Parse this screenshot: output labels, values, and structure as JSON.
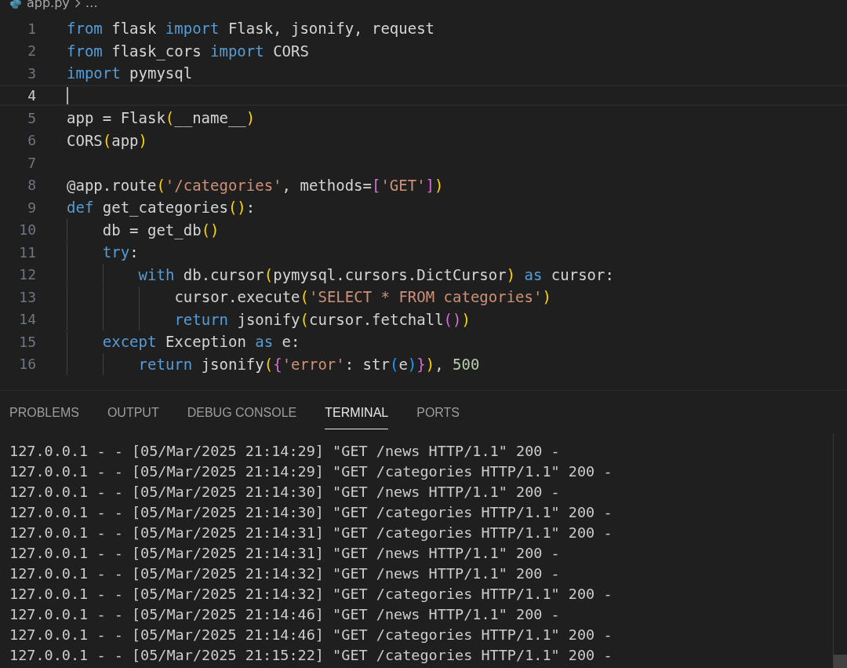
{
  "breadcrumb": {
    "file": "app.py",
    "more": "…"
  },
  "editor": {
    "lines": [
      {
        "number": "1",
        "current": false,
        "tokens": [
          {
            "kind": "keyword",
            "text": "from"
          },
          {
            "kind": "plain",
            "text": " flask "
          },
          {
            "kind": "keyword",
            "text": "import"
          },
          {
            "kind": "plain",
            "text": " Flask, jsonify, request"
          }
        ]
      },
      {
        "number": "2",
        "current": false,
        "tokens": [
          {
            "kind": "keyword",
            "text": "from"
          },
          {
            "kind": "plain",
            "text": " flask_cors "
          },
          {
            "kind": "keyword",
            "text": "import"
          },
          {
            "kind": "plain",
            "text": " CORS"
          }
        ]
      },
      {
        "number": "3",
        "current": false,
        "tokens": [
          {
            "kind": "keyword",
            "text": "import"
          },
          {
            "kind": "plain",
            "text": " pymysql"
          }
        ]
      },
      {
        "number": "4",
        "current": true
      },
      {
        "number": "5",
        "current": false,
        "tokens": [
          {
            "kind": "plain",
            "text": "app = Flask"
          },
          {
            "kind": "bracket1",
            "text": "("
          },
          {
            "kind": "plain",
            "text": "__name__"
          },
          {
            "kind": "bracket1",
            "text": ")"
          }
        ]
      },
      {
        "number": "6",
        "current": false,
        "tokens": [
          {
            "kind": "plain",
            "text": "CORS"
          },
          {
            "kind": "bracket1",
            "text": "("
          },
          {
            "kind": "plain",
            "text": "app"
          },
          {
            "kind": "bracket1",
            "text": ")"
          }
        ]
      },
      {
        "number": "7",
        "current": false
      },
      {
        "number": "8",
        "current": false,
        "tokens": [
          {
            "kind": "plain",
            "text": "@app.route"
          },
          {
            "kind": "bracket1",
            "text": "("
          },
          {
            "kind": "string",
            "text": "'/categories'"
          },
          {
            "kind": "plain",
            "text": ", methods="
          },
          {
            "kind": "bracket2",
            "text": "["
          },
          {
            "kind": "string",
            "text": "'GET'"
          },
          {
            "kind": "bracket2",
            "text": "]"
          },
          {
            "kind": "bracket1",
            "text": ")"
          }
        ]
      },
      {
        "number": "9",
        "current": false,
        "tokens": [
          {
            "kind": "keyword",
            "text": "def"
          },
          {
            "kind": "plain",
            "text": " get_categories"
          },
          {
            "kind": "bracket1",
            "text": "()"
          },
          {
            "kind": "plain",
            "text": ":"
          }
        ]
      },
      {
        "number": "10",
        "current": false,
        "tokens": [
          {
            "kind": "plain",
            "text": "    db = get_db"
          },
          {
            "kind": "bracket1",
            "text": "()"
          }
        ]
      },
      {
        "number": "11",
        "current": false,
        "tokens": [
          {
            "kind": "keyword",
            "text": "    try"
          },
          {
            "kind": "plain",
            "text": ":"
          }
        ]
      },
      {
        "number": "12",
        "current": false,
        "tokens": [
          {
            "kind": "keyword",
            "text": "        with"
          },
          {
            "kind": "plain",
            "text": " db.cursor"
          },
          {
            "kind": "bracket1",
            "text": "("
          },
          {
            "kind": "plain",
            "text": "pymysql.cursors.DictCursor"
          },
          {
            "kind": "bracket1",
            "text": ")"
          },
          {
            "kind": "keyword",
            "text": " as"
          },
          {
            "kind": "plain",
            "text": " cursor:"
          }
        ]
      },
      {
        "number": "13",
        "current": false,
        "tokens": [
          {
            "kind": "plain",
            "text": "            cursor.execute"
          },
          {
            "kind": "bracket1",
            "text": "("
          },
          {
            "kind": "string",
            "text": "'SELECT * FROM categories'"
          },
          {
            "kind": "bracket1",
            "text": ")"
          }
        ]
      },
      {
        "number": "14",
        "current": false,
        "tokens": [
          {
            "kind": "keyword",
            "text": "            return"
          },
          {
            "kind": "plain",
            "text": " jsonify"
          },
          {
            "kind": "bracket1",
            "text": "("
          },
          {
            "kind": "plain",
            "text": "cursor.fetchall"
          },
          {
            "kind": "bracket2",
            "text": "()"
          },
          {
            "kind": "bracket1",
            "text": ")"
          }
        ]
      },
      {
        "number": "15",
        "current": false,
        "tokens": [
          {
            "kind": "keyword",
            "text": "    except"
          },
          {
            "kind": "plain",
            "text": " Exception "
          },
          {
            "kind": "keyword",
            "text": "as"
          },
          {
            "kind": "plain",
            "text": " e:"
          }
        ]
      },
      {
        "number": "16",
        "current": false,
        "tokens": [
          {
            "kind": "keyword",
            "text": "        return"
          },
          {
            "kind": "plain",
            "text": " jsonify"
          },
          {
            "kind": "bracket1",
            "text": "("
          },
          {
            "kind": "bracket2",
            "text": "{"
          },
          {
            "kind": "string",
            "text": "'error'"
          },
          {
            "kind": "plain",
            "text": ": str"
          },
          {
            "kind": "bracket3",
            "text": "("
          },
          {
            "kind": "plain",
            "text": "e"
          },
          {
            "kind": "bracket3",
            "text": ")"
          },
          {
            "kind": "bracket2",
            "text": "}"
          },
          {
            "kind": "bracket1",
            "text": ")"
          },
          {
            "kind": "plain",
            "text": ", "
          },
          {
            "kind": "number",
            "text": "500"
          }
        ]
      }
    ]
  },
  "panel_tabs": [
    {
      "label": "PROBLEMS",
      "selected": false
    },
    {
      "label": "OUTPUT",
      "selected": false
    },
    {
      "label": "DEBUG CONSOLE",
      "selected": false
    },
    {
      "label": "TERMINAL",
      "selected": true
    },
    {
      "label": "PORTS",
      "selected": false
    }
  ],
  "terminal": {
    "lines": [
      "127.0.0.1 - - [05/Mar/2025 21:14:29] \"GET /news HTTP/1.1\" 200 -",
      "127.0.0.1 - - [05/Mar/2025 21:14:29] \"GET /categories HTTP/1.1\" 200 -",
      "127.0.0.1 - - [05/Mar/2025 21:14:30] \"GET /news HTTP/1.1\" 200 -",
      "127.0.0.1 - - [05/Mar/2025 21:14:30] \"GET /categories HTTP/1.1\" 200 -",
      "127.0.0.1 - - [05/Mar/2025 21:14:31] \"GET /categories HTTP/1.1\" 200 -",
      "127.0.0.1 - - [05/Mar/2025 21:14:31] \"GET /news HTTP/1.1\" 200 -",
      "127.0.0.1 - - [05/Mar/2025 21:14:32] \"GET /news HTTP/1.1\" 200 -",
      "127.0.0.1 - - [05/Mar/2025 21:14:32] \"GET /categories HTTP/1.1\" 200 -",
      "127.0.0.1 - - [05/Mar/2025 21:14:46] \"GET /news HTTP/1.1\" 200 -",
      "127.0.0.1 - - [05/Mar/2025 21:14:46] \"GET /categories HTTP/1.1\" 200 -",
      "127.0.0.1 - - [05/Mar/2025 21:15:22] \"GET /categories HTTP/1.1\" 200 -"
    ]
  }
}
